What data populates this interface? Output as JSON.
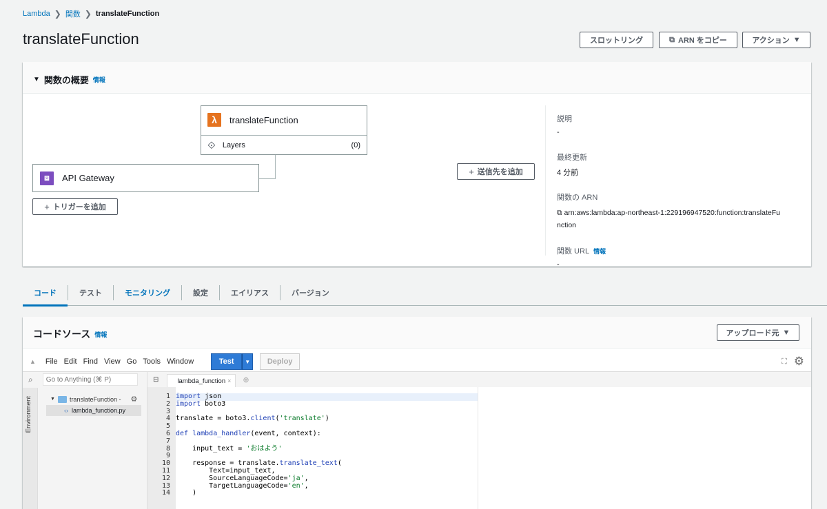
{
  "breadcrumb": {
    "root": "Lambda",
    "section": "関数",
    "current": "translateFunction"
  },
  "page": {
    "title": "translateFunction"
  },
  "header_buttons": {
    "throttle": "スロットリング",
    "copy_arn": "ARN をコピー",
    "actions": "アクション"
  },
  "overview": {
    "heading": "関数の概要",
    "info": "情報",
    "function_name": "translateFunction",
    "layers_label": "Layers",
    "layers_count": "(0)",
    "trigger_name": "API Gateway",
    "add_trigger": "トリガーを追加",
    "add_destination": "送信先を追加",
    "description_label": "説明",
    "description_value": "-",
    "last_modified_label": "最終更新",
    "last_modified_value": "4 分前",
    "arn_label": "関数の ARN",
    "arn_value": "arn:aws:lambda:ap-northeast-1:229196947520:function:translateFu",
    "arn_value_cont": "nction",
    "url_label": "関数 URL",
    "url_info": "情報",
    "url_value": "-"
  },
  "tabs": [
    "コード",
    "テスト",
    "モニタリング",
    "設定",
    "エイリアス",
    "バージョン"
  ],
  "code_source": {
    "heading": "コードソース",
    "info": "情報",
    "upload": "アップロード元"
  },
  "ide": {
    "menu": [
      "File",
      "Edit",
      "Find",
      "View",
      "Go",
      "Tools",
      "Window"
    ],
    "test": "Test",
    "deploy": "Deploy",
    "search_placeholder": "Go to Anything (⌘ P)",
    "env_label": "Environment",
    "folder": "translateFunction -",
    "file": "lambda_function.py",
    "editor_tab": "lambda_function",
    "line_numbers": [
      "1",
      "2",
      "3",
      "4",
      "5",
      "6",
      "7",
      "8",
      "9",
      "10",
      "11",
      "12",
      "13",
      "14"
    ]
  },
  "colors": {
    "accent": "#0073bb",
    "lambda": "#e5731f",
    "api_gateway": "#7c4dbf",
    "test_button": "#2e7bd6"
  }
}
